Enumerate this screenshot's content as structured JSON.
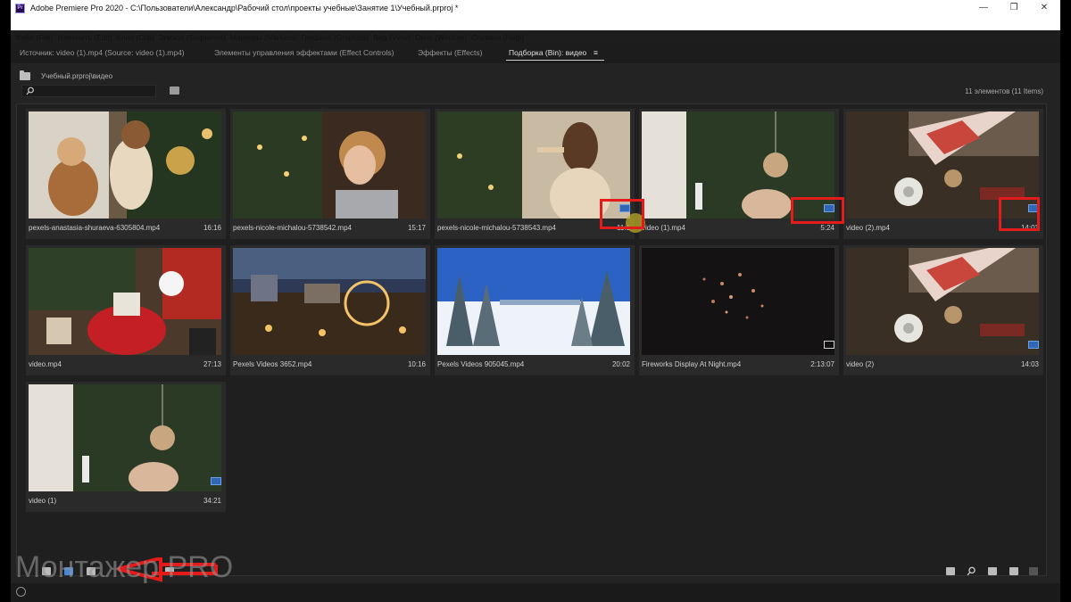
{
  "window": {
    "title": "Adobe Premiere Pro 2020 - C:\\Пользователи\\Александр\\Рабочий стол\\проекты учебные\\Занятие 1\\Учебный.prproj *",
    "app_icon_label": "Pr"
  },
  "menu": [
    "Файл (File)",
    "Изменить (Edit)",
    "Клип (Clip)",
    "Эпизод (Sequence)",
    "Маркеры (Markers)",
    "Графика (Graphics)",
    "Вид (View)",
    "Окно (Window)",
    "Справка (Help)"
  ],
  "tabs": [
    {
      "label": "Источник: video (1).mp4 (Source: video (1).mp4)",
      "active": false
    },
    {
      "label": "Элементы управления эффектами (Effect Controls)",
      "active": false
    },
    {
      "label": "Эффекты (Effects)",
      "active": false
    },
    {
      "label": "Подборка (Bin): видео",
      "active": true
    }
  ],
  "tab_menu_icon": "≡",
  "bin": {
    "path": "Учебный.prproj\\видео",
    "search_placeholder": "",
    "item_count": "11 элементов (11 Items)"
  },
  "items": [
    {
      "name": "pexels-anastasia-shuraeva-6305804.mp4",
      "duration": "16:16",
      "badge": "none"
    },
    {
      "name": "pexels-nicole-michalou-5738542.mp4",
      "duration": "15:17",
      "badge": "none"
    },
    {
      "name": "pexels-nicole-michalou-5738543.mp4",
      "duration": "11:1",
      "badge": "blue"
    },
    {
      "name": "video (1).mp4",
      "duration": "5:24",
      "badge": "blue"
    },
    {
      "name": "video (2).mp4",
      "duration": "14:03",
      "badge": "blue"
    },
    {
      "name": "video.mp4",
      "duration": "27:13",
      "badge": "none"
    },
    {
      "name": "Pexels Videos 3652.mp4",
      "duration": "10:16",
      "badge": "none"
    },
    {
      "name": "Pexels Videos 905045.mp4",
      "duration": "20:02",
      "badge": "none"
    },
    {
      "name": "Fireworks Display At Night.mp4",
      "duration": "2:13:07",
      "badge": "white"
    },
    {
      "name": "video (2)",
      "duration": "14:03",
      "badge": "blue"
    },
    {
      "name": "video (1)",
      "duration": "34:21",
      "badge": "blue"
    }
  ],
  "watermark": "Монтажер PRO",
  "colors": {
    "accent_red": "#e31b1b",
    "badge_blue": "#2f66b6",
    "panel_bg": "#232323"
  },
  "icons": [
    "search-icon",
    "new-bin-icon",
    "folder-icon",
    "list-view-icon",
    "icon-view-icon",
    "freeform-view-icon",
    "find-icon",
    "new-item-icon",
    "trash-icon",
    "arrow-annotation-icon"
  ]
}
